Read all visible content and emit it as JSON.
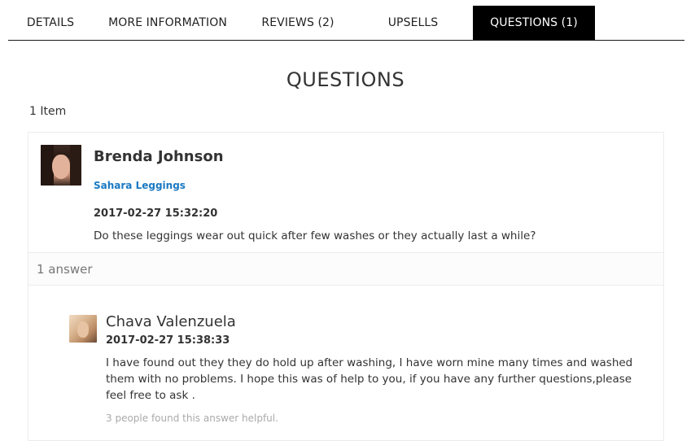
{
  "tabs": [
    {
      "label": "DETAILS",
      "active": false
    },
    {
      "label": "MORE INFORMATION",
      "active": false
    },
    {
      "label": "REVIEWS (2)",
      "active": false
    },
    {
      "label": "UPSELLS",
      "active": false
    },
    {
      "label": "QUESTIONS (1)",
      "active": true
    }
  ],
  "section": {
    "heading": "QUESTIONS",
    "item_count": "1 Item"
  },
  "question": {
    "author": "Brenda Johnson",
    "product": "Sahara Leggings",
    "date": "2017-02-27 15:32:20",
    "text": "Do these leggings wear out quick after few washes or they actually last a while?",
    "answer_count": "1 answer",
    "answer": {
      "author": "Chava Valenzuela",
      "date": "2017-02-27 15:38:33",
      "text": "I have found out they they do hold up after washing, I have worn mine many times and washed them with no problems. I hope this was of help to you, if you have any further questions,please feel free to ask .",
      "helpful": "3 people found this answer helpful."
    }
  },
  "colors": {
    "active_tab_bg": "#000000",
    "link": "#1979c3",
    "muted": "#aaaaaa"
  }
}
